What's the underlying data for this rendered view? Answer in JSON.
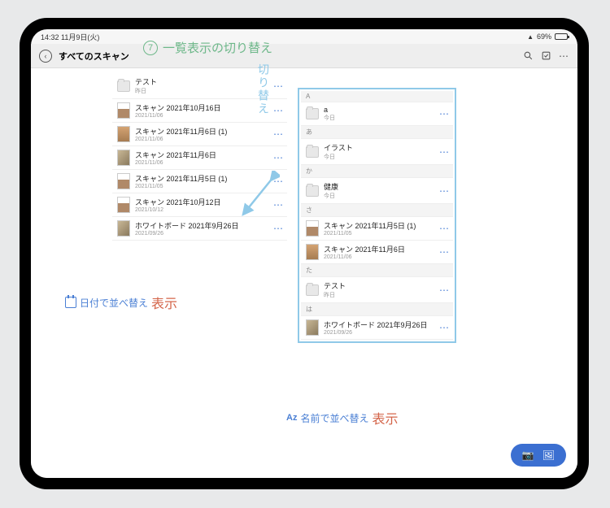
{
  "status": {
    "time": "14:32",
    "date": "11月9日(火)",
    "battery": "69%"
  },
  "toolbar": {
    "title": "すべてのスキャン"
  },
  "annotations": {
    "step_number": "7",
    "step_title": "一覧表示の切り替え",
    "vertical_label": "切り替え",
    "sort_date": {
      "label": "日付で並べ替え",
      "display": "表示"
    },
    "sort_name": {
      "prefix": "Az",
      "label": "名前で並べ替え",
      "display": "表示"
    }
  },
  "left_list": [
    {
      "kind": "folder",
      "name": "テスト",
      "date": "昨日"
    },
    {
      "kind": "photo3",
      "name": "スキャン 2021年10月16日",
      "date": "2021/11/06"
    },
    {
      "kind": "photo2",
      "name": "スキャン 2021年11月6日 (1)",
      "date": "2021/11/06"
    },
    {
      "kind": "photo",
      "name": "スキャン 2021年11月6日",
      "date": "2021/11/06"
    },
    {
      "kind": "photo3",
      "name": "スキャン 2021年11月5日 (1)",
      "date": "2021/11/05"
    },
    {
      "kind": "photo3",
      "name": "スキャン 2021年10月12日",
      "date": "2021/10/12"
    },
    {
      "kind": "photo",
      "name": "ホワイトボード 2021年9月26日",
      "date": "2021/09/26"
    }
  ],
  "right_sections": [
    {
      "header": "A",
      "items": [
        {
          "kind": "folder",
          "name": "a",
          "date": "今日"
        }
      ]
    },
    {
      "header": "あ",
      "items": [
        {
          "kind": "folder",
          "name": "イラスト",
          "date": "今日"
        }
      ]
    },
    {
      "header": "か",
      "items": [
        {
          "kind": "folder",
          "name": "健康",
          "date": "今日"
        }
      ]
    },
    {
      "header": "さ",
      "items": [
        {
          "kind": "photo3",
          "name": "スキャン 2021年11月5日 (1)",
          "date": "2021/11/05"
        },
        {
          "kind": "photo2",
          "name": "スキャン 2021年11月6日",
          "date": "2021/11/06"
        }
      ]
    },
    {
      "header": "た",
      "items": [
        {
          "kind": "folder",
          "name": "テスト",
          "date": "昨日"
        }
      ]
    },
    {
      "header": "は",
      "items": [
        {
          "kind": "photo",
          "name": "ホワイトボード 2021年9月26日",
          "date": "2021/09/26"
        }
      ]
    }
  ]
}
